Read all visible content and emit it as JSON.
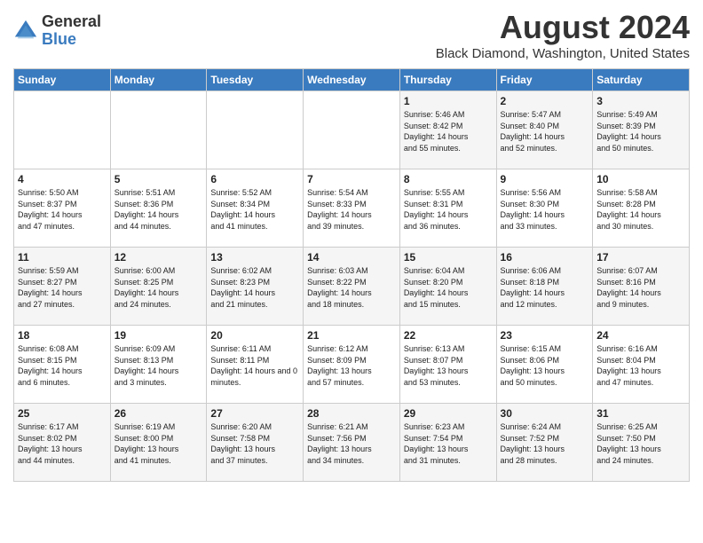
{
  "header": {
    "logo_general": "General",
    "logo_blue": "Blue",
    "month_year": "August 2024",
    "location": "Black Diamond, Washington, United States"
  },
  "days_of_week": [
    "Sunday",
    "Monday",
    "Tuesday",
    "Wednesday",
    "Thursday",
    "Friday",
    "Saturday"
  ],
  "weeks": [
    [
      {
        "day": "",
        "info": ""
      },
      {
        "day": "",
        "info": ""
      },
      {
        "day": "",
        "info": ""
      },
      {
        "day": "",
        "info": ""
      },
      {
        "day": "1",
        "info": "Sunrise: 5:46 AM\nSunset: 8:42 PM\nDaylight: 14 hours\nand 55 minutes."
      },
      {
        "day": "2",
        "info": "Sunrise: 5:47 AM\nSunset: 8:40 PM\nDaylight: 14 hours\nand 52 minutes."
      },
      {
        "day": "3",
        "info": "Sunrise: 5:49 AM\nSunset: 8:39 PM\nDaylight: 14 hours\nand 50 minutes."
      }
    ],
    [
      {
        "day": "4",
        "info": "Sunrise: 5:50 AM\nSunset: 8:37 PM\nDaylight: 14 hours\nand 47 minutes."
      },
      {
        "day": "5",
        "info": "Sunrise: 5:51 AM\nSunset: 8:36 PM\nDaylight: 14 hours\nand 44 minutes."
      },
      {
        "day": "6",
        "info": "Sunrise: 5:52 AM\nSunset: 8:34 PM\nDaylight: 14 hours\nand 41 minutes."
      },
      {
        "day": "7",
        "info": "Sunrise: 5:54 AM\nSunset: 8:33 PM\nDaylight: 14 hours\nand 39 minutes."
      },
      {
        "day": "8",
        "info": "Sunrise: 5:55 AM\nSunset: 8:31 PM\nDaylight: 14 hours\nand 36 minutes."
      },
      {
        "day": "9",
        "info": "Sunrise: 5:56 AM\nSunset: 8:30 PM\nDaylight: 14 hours\nand 33 minutes."
      },
      {
        "day": "10",
        "info": "Sunrise: 5:58 AM\nSunset: 8:28 PM\nDaylight: 14 hours\nand 30 minutes."
      }
    ],
    [
      {
        "day": "11",
        "info": "Sunrise: 5:59 AM\nSunset: 8:27 PM\nDaylight: 14 hours\nand 27 minutes."
      },
      {
        "day": "12",
        "info": "Sunrise: 6:00 AM\nSunset: 8:25 PM\nDaylight: 14 hours\nand 24 minutes."
      },
      {
        "day": "13",
        "info": "Sunrise: 6:02 AM\nSunset: 8:23 PM\nDaylight: 14 hours\nand 21 minutes."
      },
      {
        "day": "14",
        "info": "Sunrise: 6:03 AM\nSunset: 8:22 PM\nDaylight: 14 hours\nand 18 minutes."
      },
      {
        "day": "15",
        "info": "Sunrise: 6:04 AM\nSunset: 8:20 PM\nDaylight: 14 hours\nand 15 minutes."
      },
      {
        "day": "16",
        "info": "Sunrise: 6:06 AM\nSunset: 8:18 PM\nDaylight: 14 hours\nand 12 minutes."
      },
      {
        "day": "17",
        "info": "Sunrise: 6:07 AM\nSunset: 8:16 PM\nDaylight: 14 hours\nand 9 minutes."
      }
    ],
    [
      {
        "day": "18",
        "info": "Sunrise: 6:08 AM\nSunset: 8:15 PM\nDaylight: 14 hours\nand 6 minutes."
      },
      {
        "day": "19",
        "info": "Sunrise: 6:09 AM\nSunset: 8:13 PM\nDaylight: 14 hours\nand 3 minutes."
      },
      {
        "day": "20",
        "info": "Sunrise: 6:11 AM\nSunset: 8:11 PM\nDaylight: 14 hours and 0 minutes."
      },
      {
        "day": "21",
        "info": "Sunrise: 6:12 AM\nSunset: 8:09 PM\nDaylight: 13 hours\nand 57 minutes."
      },
      {
        "day": "22",
        "info": "Sunrise: 6:13 AM\nSunset: 8:07 PM\nDaylight: 13 hours\nand 53 minutes."
      },
      {
        "day": "23",
        "info": "Sunrise: 6:15 AM\nSunset: 8:06 PM\nDaylight: 13 hours\nand 50 minutes."
      },
      {
        "day": "24",
        "info": "Sunrise: 6:16 AM\nSunset: 8:04 PM\nDaylight: 13 hours\nand 47 minutes."
      }
    ],
    [
      {
        "day": "25",
        "info": "Sunrise: 6:17 AM\nSunset: 8:02 PM\nDaylight: 13 hours\nand 44 minutes."
      },
      {
        "day": "26",
        "info": "Sunrise: 6:19 AM\nSunset: 8:00 PM\nDaylight: 13 hours\nand 41 minutes."
      },
      {
        "day": "27",
        "info": "Sunrise: 6:20 AM\nSunset: 7:58 PM\nDaylight: 13 hours\nand 37 minutes."
      },
      {
        "day": "28",
        "info": "Sunrise: 6:21 AM\nSunset: 7:56 PM\nDaylight: 13 hours\nand 34 minutes."
      },
      {
        "day": "29",
        "info": "Sunrise: 6:23 AM\nSunset: 7:54 PM\nDaylight: 13 hours\nand 31 minutes."
      },
      {
        "day": "30",
        "info": "Sunrise: 6:24 AM\nSunset: 7:52 PM\nDaylight: 13 hours\nand 28 minutes."
      },
      {
        "day": "31",
        "info": "Sunrise: 6:25 AM\nSunset: 7:50 PM\nDaylight: 13 hours\nand 24 minutes."
      }
    ]
  ]
}
